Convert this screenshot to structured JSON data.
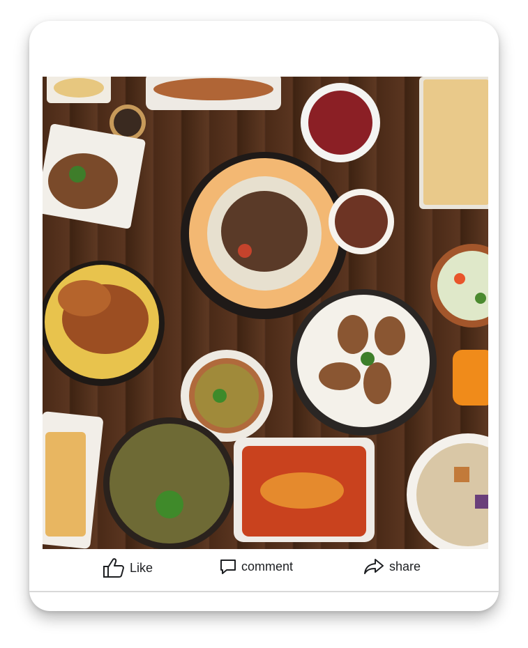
{
  "post": {
    "photo_alt": "",
    "actions": {
      "like_label": "Like",
      "comment_label": "comment",
      "share_label": "share"
    }
  },
  "colors": {
    "action_text": "#1c1e21",
    "table_wood": "#4a2a17"
  }
}
